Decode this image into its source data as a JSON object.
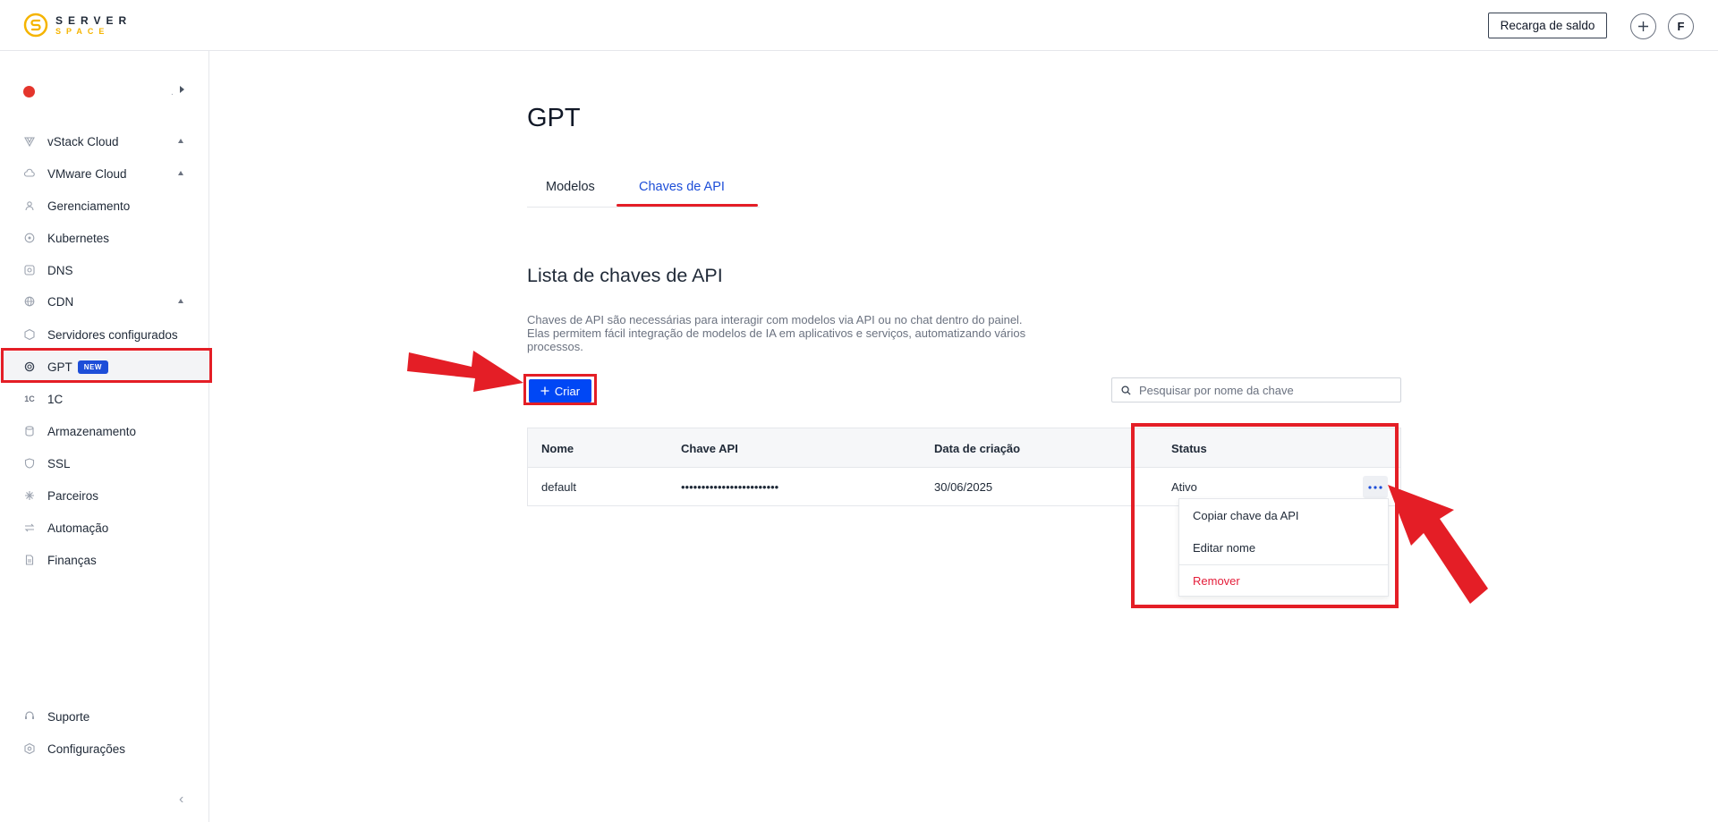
{
  "header": {
    "logo_top": "SERVER",
    "logo_bottom": "SPACE",
    "recharge_label": "Recarga de saldo",
    "plus_label": "+",
    "avatar_initial": "F"
  },
  "sidebar": {
    "project_dot_color": "#e4352c",
    "items": [
      {
        "label": "vStack Cloud",
        "icon": "vstack-icon",
        "expandable": true
      },
      {
        "label": "VMware Cloud",
        "icon": "cloud-icon",
        "expandable": true
      },
      {
        "label": "Gerenciamento",
        "icon": "user-icon",
        "expandable": false
      },
      {
        "label": "Kubernetes",
        "icon": "kubernetes-icon",
        "expandable": false
      },
      {
        "label": "DNS",
        "icon": "dns-icon",
        "expandable": false
      },
      {
        "label": "CDN",
        "icon": "globe-icon",
        "expandable": true
      },
      {
        "label": "Servidores configurados",
        "icon": "server-icon",
        "expandable": false
      },
      {
        "label": "GPT",
        "icon": "openai-icon",
        "expandable": false,
        "badge": "NEW",
        "active": true
      },
      {
        "label": "1C",
        "icon": "onec-icon",
        "expandable": false
      },
      {
        "label": "Armazenamento",
        "icon": "database-icon",
        "expandable": false
      },
      {
        "label": "SSL",
        "icon": "shield-icon",
        "expandable": false
      },
      {
        "label": "Parceiros",
        "icon": "partners-icon",
        "expandable": false
      },
      {
        "label": "Automação",
        "icon": "automation-icon",
        "expandable": false
      },
      {
        "label": "Finanças",
        "icon": "document-icon",
        "expandable": false
      }
    ],
    "bottom_items": [
      {
        "label": "Suporte",
        "icon": "headset-icon"
      },
      {
        "label": "Configurações",
        "icon": "settings-icon"
      }
    ]
  },
  "main": {
    "page_title": "GPT",
    "tabs": [
      {
        "label": "Modelos",
        "active": false
      },
      {
        "label": "Chaves de API",
        "active": true
      }
    ],
    "section_title": "Lista de chaves de API",
    "description_line1": "Chaves de API são necessárias para interagir com modelos via API ou no chat dentro do painel.",
    "description_line2": "Elas permitem fácil integração de modelos de IA em aplicativos e serviços, automatizando vários",
    "description_line3": "processos.",
    "create_label": "Criar",
    "search_placeholder": "Pesquisar por nome da chave",
    "table": {
      "columns": [
        "Nome",
        "Chave API",
        "Data de criação",
        "Status"
      ],
      "rows": [
        {
          "name": "default",
          "key": "••••••••••••••••••••••••",
          "created": "30/06/2025",
          "status": "Ativo"
        }
      ]
    },
    "row_menu": {
      "copy": "Copiar chave da API",
      "edit": "Editar nome",
      "remove": "Remover"
    }
  },
  "colors": {
    "accent": "#0047f5",
    "annotation_red": "#e41e26",
    "danger": "#e41e3a",
    "brand_yellow": "#f5b400"
  }
}
